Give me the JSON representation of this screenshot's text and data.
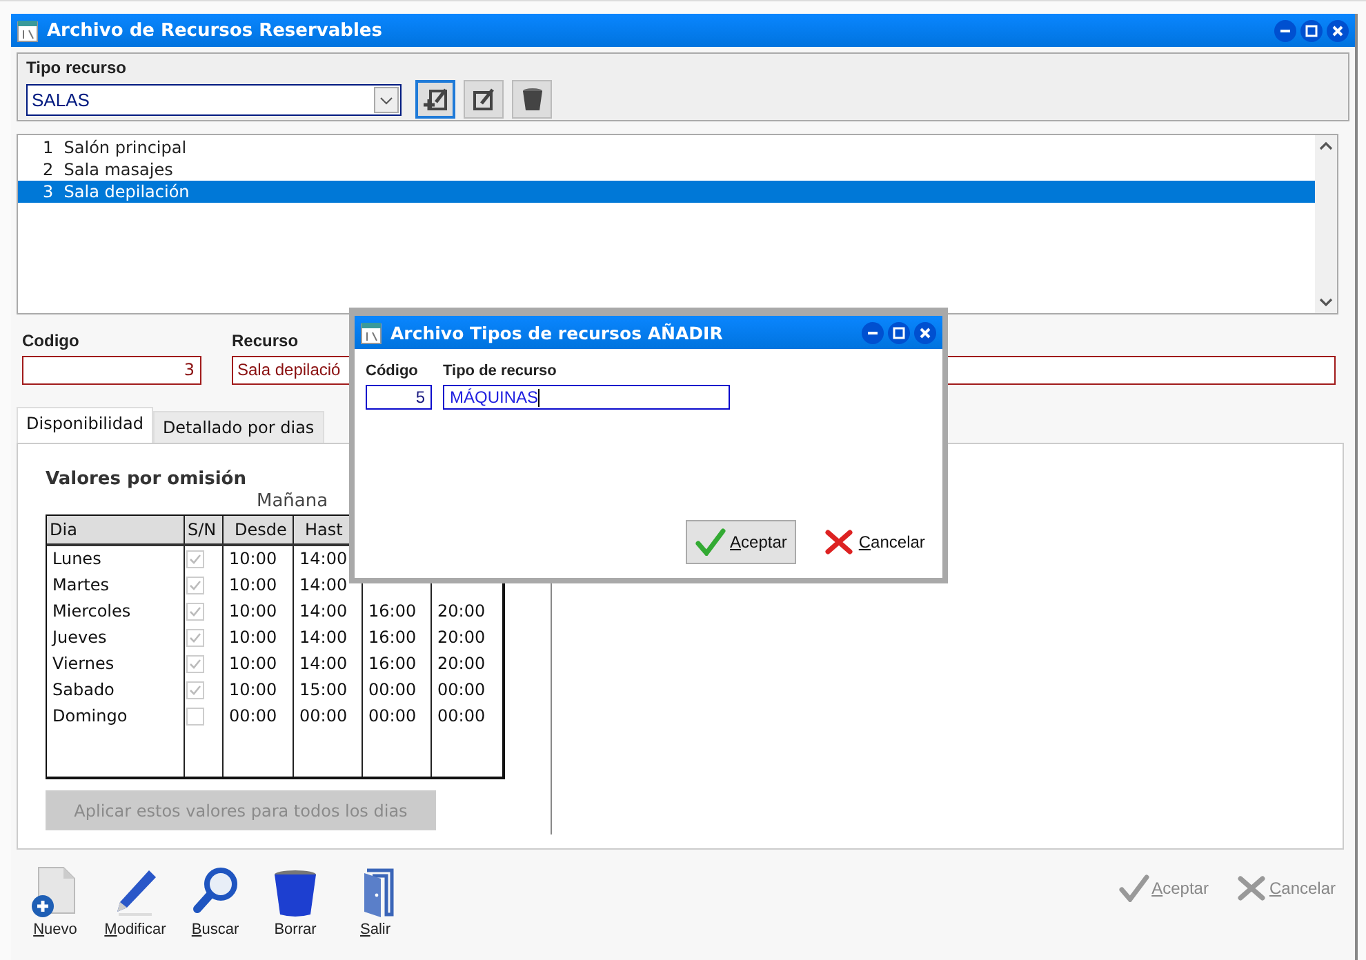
{
  "window": {
    "title": "Archivo de Recursos Reservables"
  },
  "tipo_recurso": {
    "label": "Tipo recurso",
    "value": "SALAS"
  },
  "resources": [
    {
      "code": "1",
      "name": "Salón principal",
      "selected": false
    },
    {
      "code": "2",
      "name": "Sala masajes",
      "selected": false
    },
    {
      "code": "3",
      "name": "Sala depilación",
      "selected": true
    }
  ],
  "codigo": {
    "label": "Codigo",
    "value": "3"
  },
  "recurso": {
    "label": "Recurso",
    "value": "Sala depilació"
  },
  "tabs": [
    {
      "label": "Disponibilidad",
      "selected": true
    },
    {
      "label": "Detallado por dias",
      "selected": false
    }
  ],
  "defaults": {
    "title": "Valores por omisión",
    "group_label": "Mañana",
    "columns": [
      "Dia",
      "S/N",
      "Desde",
      "Hast"
    ],
    "rows": [
      {
        "day": "Lunes",
        "enabled": true,
        "times": [
          "10:00",
          "14:00"
        ]
      },
      {
        "day": "Martes",
        "enabled": true,
        "times": [
          "10:00",
          "14:00"
        ]
      },
      {
        "day": "Miercoles",
        "enabled": true,
        "times": [
          "10:00",
          "14:00",
          "16:00",
          "20:00"
        ]
      },
      {
        "day": "Jueves",
        "enabled": true,
        "times": [
          "10:00",
          "14:00",
          "16:00",
          "20:00"
        ]
      },
      {
        "day": "Viernes",
        "enabled": true,
        "times": [
          "10:00",
          "14:00",
          "16:00",
          "20:00"
        ]
      },
      {
        "day": "Sabado",
        "enabled": true,
        "times": [
          "10:00",
          "15:00",
          "00:00",
          "00:00"
        ]
      },
      {
        "day": "Domingo",
        "enabled": false,
        "times": [
          "00:00",
          "00:00",
          "00:00",
          "00:00"
        ]
      }
    ],
    "apply_button": {
      "label": "Aplicar estos valores para todos los dias",
      "disabled": true
    }
  },
  "toolbar": [
    {
      "label": "Nuevo",
      "kind": "new"
    },
    {
      "label": "Modificar",
      "kind": "edit"
    },
    {
      "label": "Buscar",
      "kind": "search"
    },
    {
      "label": "Borrar",
      "kind": "delete"
    },
    {
      "label": "Salir",
      "kind": "exit"
    }
  ],
  "footer_buttons": [
    {
      "label": "Aceptar",
      "kind": "accept",
      "disabled": true
    },
    {
      "label": "Cancelar",
      "kind": "cancel",
      "disabled": true
    }
  ],
  "dialog": {
    "title": "Archivo Tipos de recursos AÑADIR",
    "codigo": {
      "label": "Código",
      "value": "5"
    },
    "tipo": {
      "label": "Tipo de recurso",
      "value": "MÁQUINAS"
    },
    "buttons": [
      {
        "label": "Aceptar",
        "kind": "accept",
        "disabled": false
      },
      {
        "label": "Cancelar",
        "kind": "cancel",
        "disabled": false
      }
    ]
  }
}
